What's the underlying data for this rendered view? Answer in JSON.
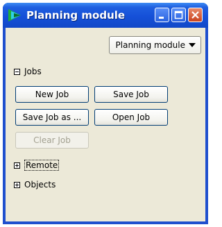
{
  "window": {
    "title": "Planning module",
    "controls": [
      "minimize-icon",
      "maximize-icon",
      "close-icon"
    ]
  },
  "module_selector": {
    "value": "Planning module"
  },
  "sections": {
    "jobs": {
      "label": "Jobs",
      "expanded": true
    },
    "remote": {
      "label": "Remote",
      "expanded": false
    },
    "objects": {
      "label": "Objects",
      "expanded": false
    }
  },
  "buttons": {
    "new_job": "New Job",
    "save_job": "Save Job",
    "save_job_as": "Save Job as ...",
    "open_job": "Open Job",
    "clear_job": "Clear Job"
  },
  "colors": {
    "titlebar": "#1550d8",
    "panel_bg": "#ece9d8",
    "button_border": "#003c74",
    "close_button": "#c9421e"
  }
}
